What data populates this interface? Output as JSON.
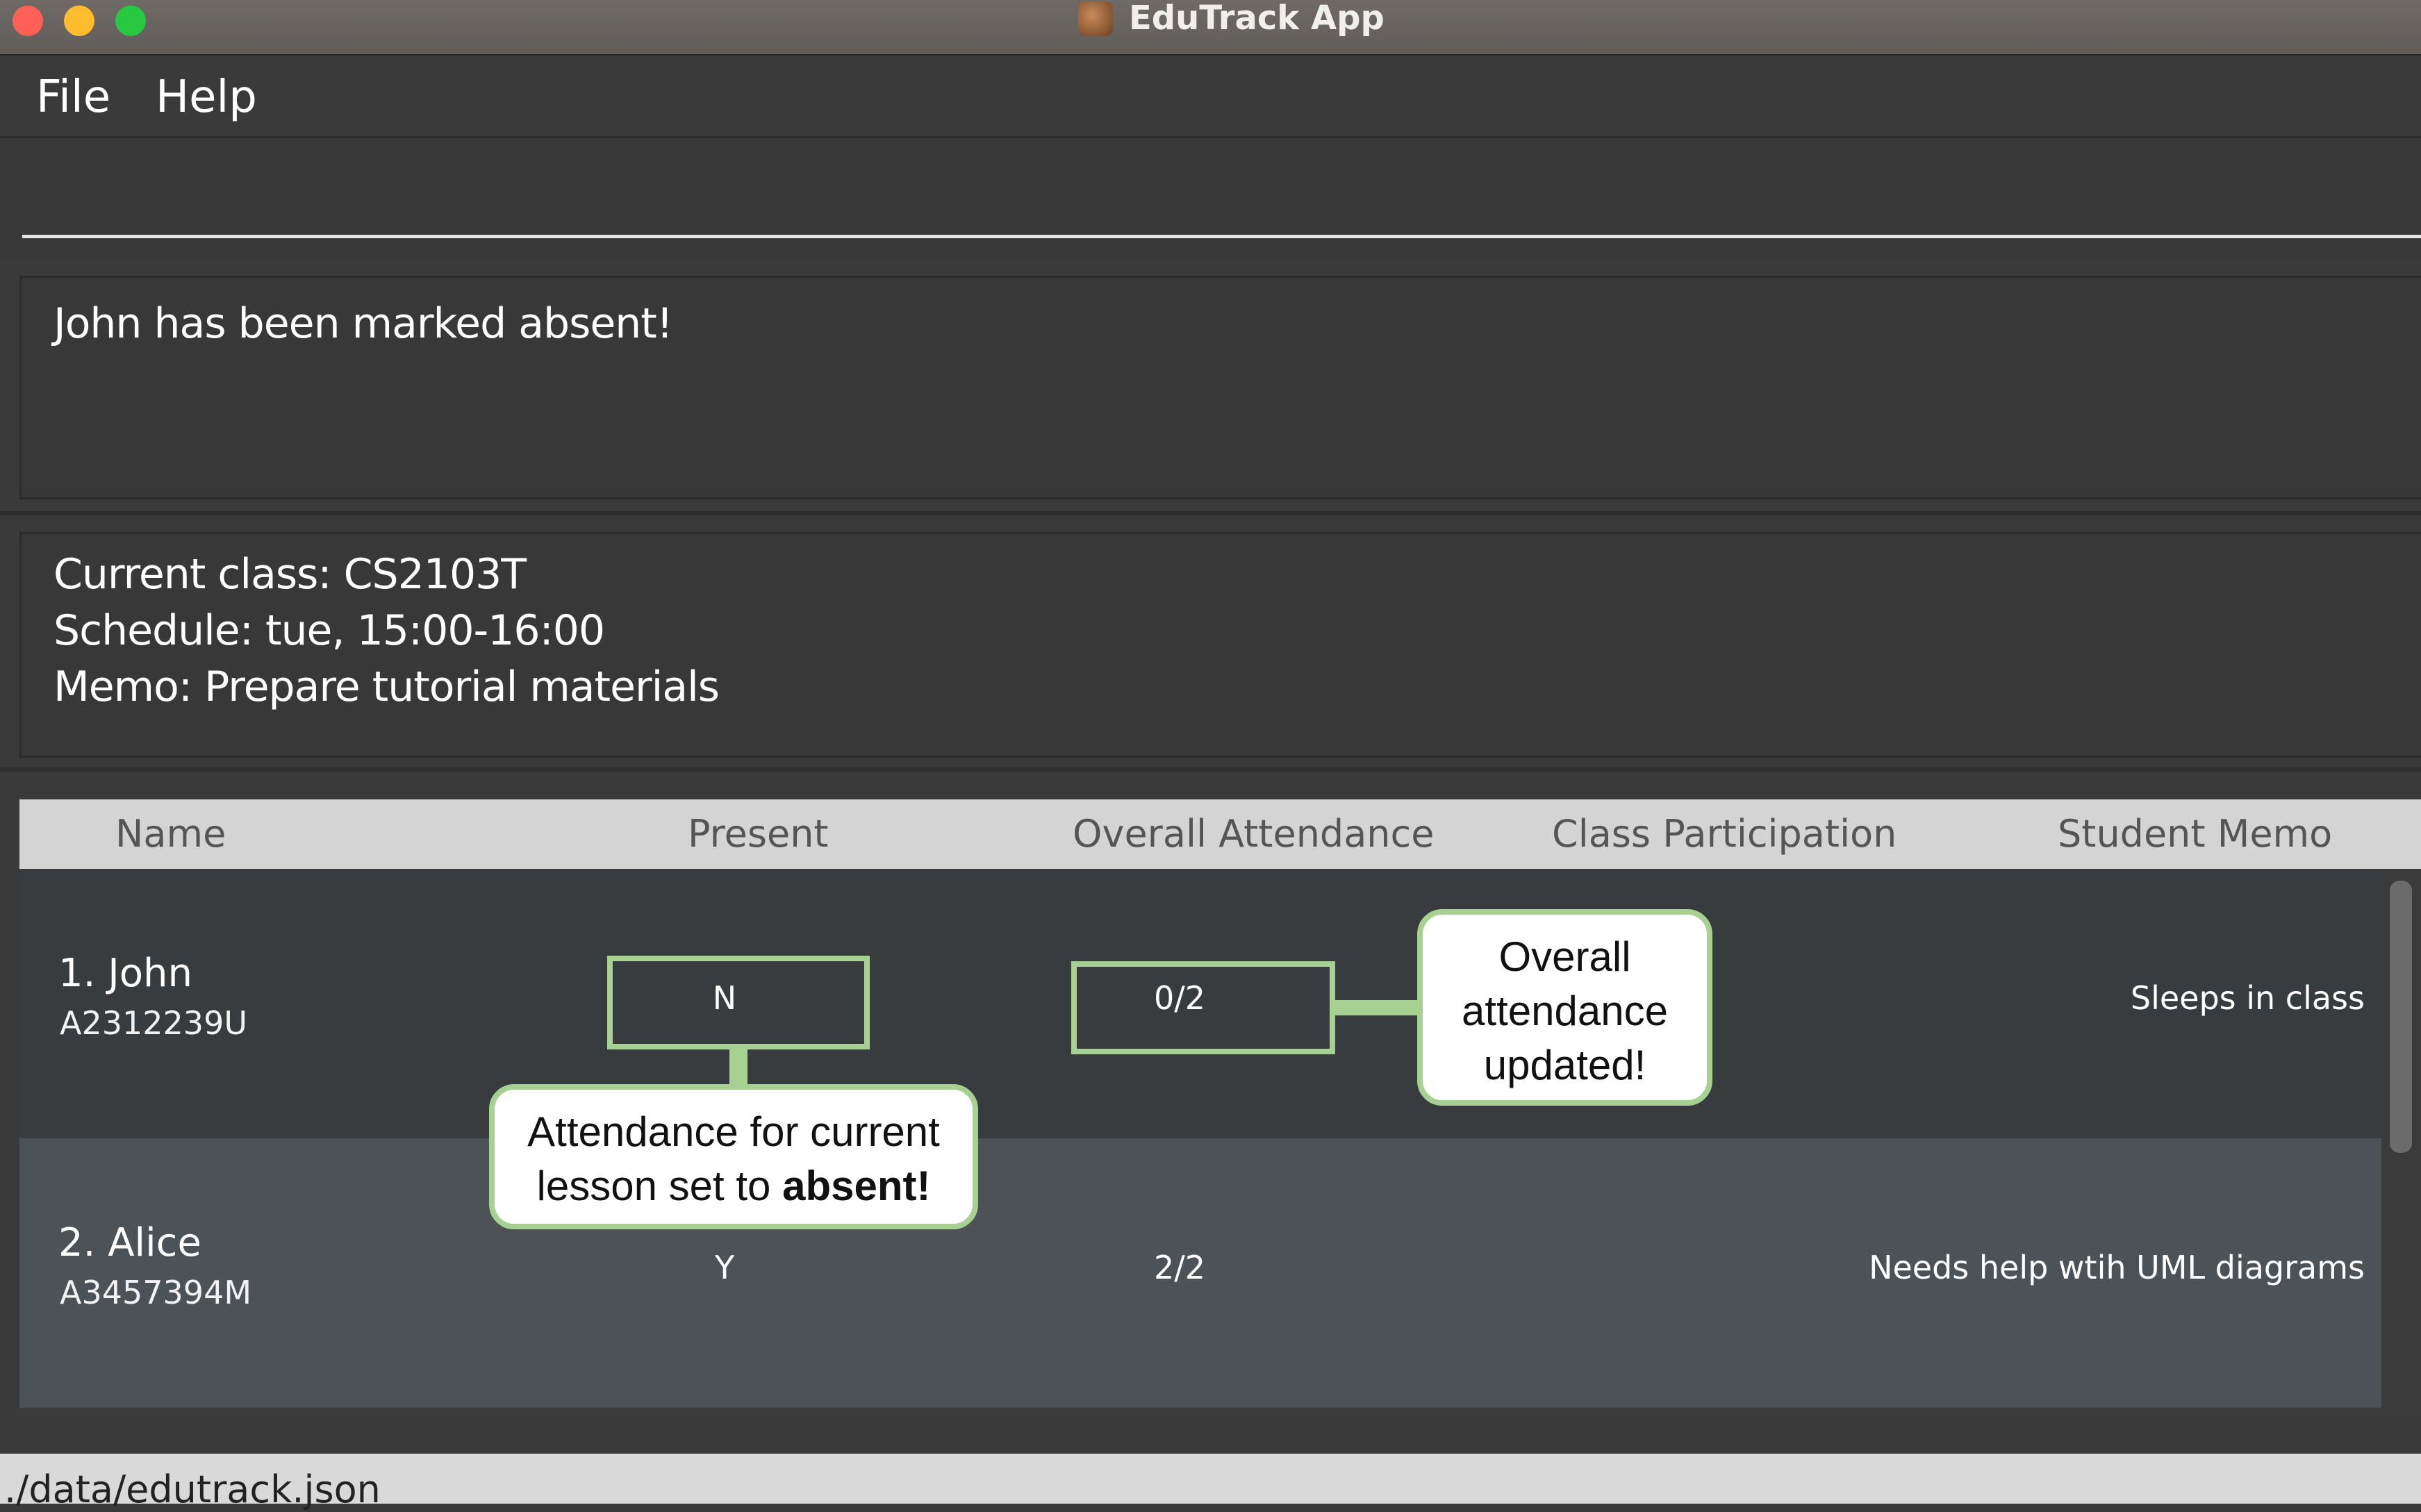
{
  "window": {
    "title": "EduTrack App"
  },
  "menu": {
    "file": "File",
    "help": "Help"
  },
  "command_box": {
    "value": "",
    "placeholder": ""
  },
  "result": {
    "message": "John has been marked absent!"
  },
  "class_info": {
    "current_class": "Current class: CS2103T",
    "schedule": "Schedule: tue, 15:00-16:00",
    "memo": "Memo: Prepare tutorial materials"
  },
  "table": {
    "headers": {
      "name": "Name",
      "present": "Present",
      "overall_attendance": "Overall Attendance",
      "class_participation": "Class Participation",
      "student_memo": "Student Memo"
    },
    "rows": [
      {
        "name": "1.  John",
        "id": "A2312239U",
        "present": "N",
        "attendance": "0/2",
        "participation": "",
        "memo": "Sleeps in class"
      },
      {
        "name": "2.  Alice",
        "id": "A3457394M",
        "present": "Y",
        "attendance": "2/2",
        "participation": "",
        "memo": "Needs help wtih UML diagrams"
      }
    ]
  },
  "status_bar": {
    "path": "./data/edutrack.json"
  },
  "annotations": {
    "present_callout": {
      "line1": "Attendance for current",
      "line2_prefix": "lesson set to ",
      "line2_bold": "absent!"
    },
    "attendance_callout": {
      "line1": "Overall",
      "line2": "attendance",
      "line3": "updated!"
    }
  },
  "colors": {
    "annotation_green": "#a6d193",
    "header_bg": "#d4d4d4",
    "row_alt": "#4d5256"
  }
}
